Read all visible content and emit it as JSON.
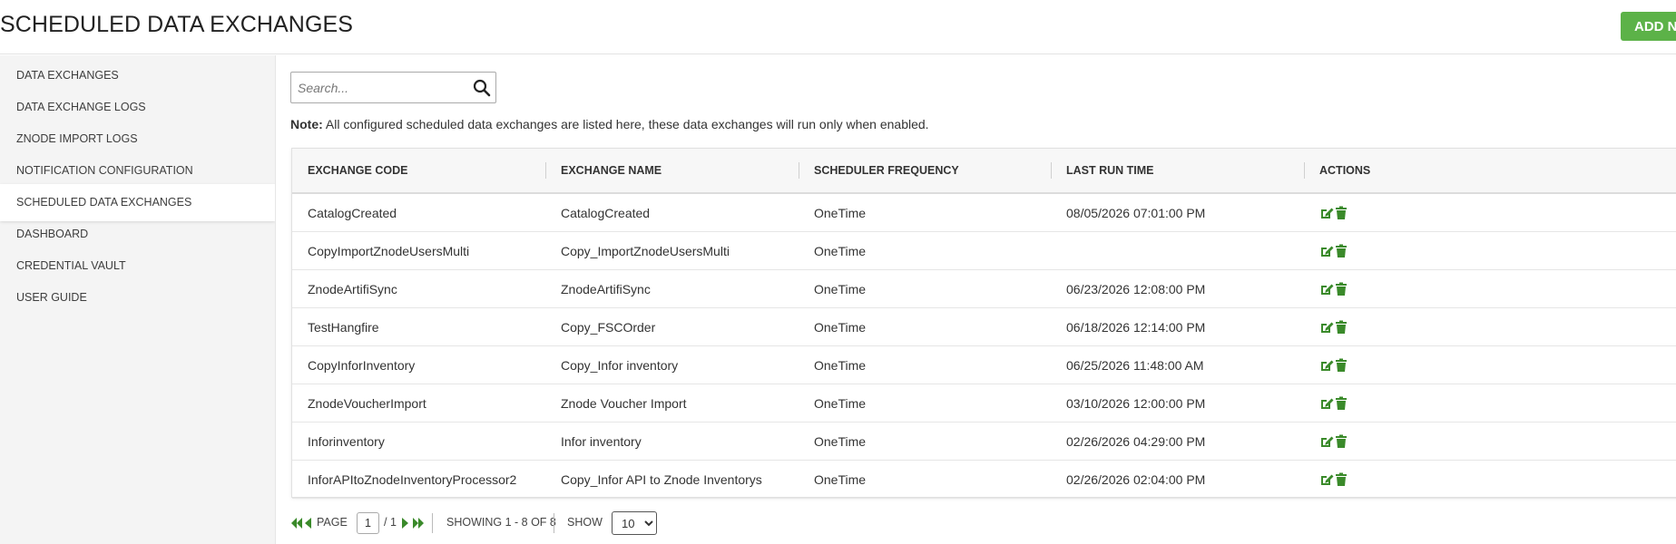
{
  "header": {
    "title": "SCHEDULED DATA EXCHANGES",
    "add_new_label": "ADD NEW"
  },
  "sidebar": {
    "items": [
      {
        "label": "DATA EXCHANGES",
        "active": false
      },
      {
        "label": "DATA EXCHANGE LOGS",
        "active": false
      },
      {
        "label": "ZNODE IMPORT LOGS",
        "active": false
      },
      {
        "label": "NOTIFICATION CONFIGURATION",
        "active": false
      },
      {
        "label": "SCHEDULED DATA EXCHANGES",
        "active": true
      },
      {
        "label": "DASHBOARD",
        "active": false
      },
      {
        "label": "CREDENTIAL VAULT",
        "active": false
      },
      {
        "label": "USER GUIDE",
        "active": false
      }
    ]
  },
  "search": {
    "placeholder": "Search...",
    "value": "",
    "icon": "search-icon"
  },
  "note": {
    "label": "Note:",
    "text": "All configured scheduled data exchanges are listed here, these data exchanges will run only when enabled."
  },
  "table": {
    "columns": [
      "EXCHANGE CODE",
      "EXCHANGE NAME",
      "SCHEDULER FREQUENCY",
      "LAST RUN TIME",
      "ACTIONS"
    ],
    "rows": [
      {
        "code": "CatalogCreated",
        "name": "CatalogCreated",
        "frequency": "OneTime",
        "last_run": "08/05/2026 07:01:00 PM"
      },
      {
        "code": "CopyImportZnodeUsersMulti",
        "name": "Copy_ImportZnodeUsersMulti",
        "frequency": "OneTime",
        "last_run": ""
      },
      {
        "code": "ZnodeArtifiSync",
        "name": "ZnodeArtifiSync",
        "frequency": "OneTime",
        "last_run": "06/23/2026 12:08:00 PM"
      },
      {
        "code": "TestHangfire",
        "name": "Copy_FSCOrder",
        "frequency": "OneTime",
        "last_run": "06/18/2026 12:14:00 PM"
      },
      {
        "code": "CopyInforInventory",
        "name": "Copy_Infor inventory",
        "frequency": "OneTime",
        "last_run": "06/25/2026 11:48:00 AM"
      },
      {
        "code": "ZnodeVoucherImport",
        "name": "Znode Voucher Import",
        "frequency": "OneTime",
        "last_run": "03/10/2026 12:00:00 PM"
      },
      {
        "code": "Inforinventory",
        "name": "Infor inventory",
        "frequency": "OneTime",
        "last_run": "02/26/2026 04:29:00 PM"
      },
      {
        "code": "InforAPItoZnodeInventoryProcessor2",
        "name": "Copy_Infor API to Znode Inventorys",
        "frequency": "OneTime",
        "last_run": "02/26/2026 02:04:00 PM"
      }
    ],
    "actions": [
      "edit-icon",
      "delete-icon"
    ]
  },
  "pager": {
    "page_label": "PAGE",
    "current_page": "1",
    "total_pages": "/ 1",
    "showing": "SHOWING 1 - 8 OF 8",
    "show_label": "SHOW",
    "page_size": "10",
    "page_size_options": [
      "10"
    ]
  },
  "colors": {
    "accent": "#5cb248",
    "icon_green": "#3a8a2a",
    "sidebar_bg": "#f4f4f4",
    "header_bg": "#f7f7f7"
  }
}
